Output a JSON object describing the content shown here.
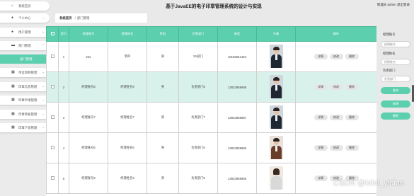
{
  "header": {
    "title": "基于JavaEE的电子印章管理系统的设计与实现",
    "user_info": "管理员 admin  退出登录"
  },
  "sidebar": {
    "items": [
      {
        "label": "系统首页",
        "icon": "home-icon",
        "chevron": false
      },
      {
        "label": "个人中心",
        "icon": "person-icon",
        "chevron": true
      },
      {
        "label": "用户管理",
        "icon": "users-icon",
        "chevron": true
      },
      {
        "label": "部门管理",
        "icon": "department-icon",
        "chevron": true
      },
      {
        "label": "部门管理",
        "icon": "",
        "chevron": false,
        "active": true
      },
      {
        "label": "单位简称管理",
        "icon": "grid-icon",
        "chevron": true
      },
      {
        "label": "印章信息管理",
        "icon": "grid-icon",
        "chevron": true
      },
      {
        "label": "印章申请管理",
        "icon": "grid-icon",
        "chevron": true
      },
      {
        "label": "印章审核管理",
        "icon": "grid-icon",
        "chevron": true
      },
      {
        "label": "印章下发管理",
        "icon": "grid-icon",
        "chevron": true
      }
    ]
  },
  "breadcrumb": {
    "home": "系统首页",
    "separator": "/",
    "current": "部门管理"
  },
  "table": {
    "columns": [
      "",
      "索引",
      "经理账号",
      "经理姓名",
      "性别",
      "负责部门",
      "电话",
      "头像",
      "操作"
    ],
    "rows": [
      {
        "index": "1",
        "account": "222",
        "name": "李四",
        "gender": "男",
        "dept": "XX部门",
        "phone": "18156561454"
      },
      {
        "index": "2",
        "account": "经理账号8",
        "name": "经理姓名8",
        "gender": "男",
        "dept": "负责部门8",
        "phone": "13823888888"
      },
      {
        "index": "3",
        "account": "经理账号7",
        "name": "经理姓名7",
        "gender": "男",
        "dept": "负责部门7",
        "phone": "13823888887"
      },
      {
        "index": "4",
        "account": "经理账号6",
        "name": "经理姓名6",
        "gender": "男",
        "dept": "负责部门6",
        "phone": "13823888886"
      },
      {
        "index": "5",
        "account": "经理账号5",
        "name": "经理姓名5",
        "gender": "男",
        "dept": "负责部门5",
        "phone": "13823888885"
      }
    ],
    "actions": {
      "detail": "详情",
      "edit": "修改",
      "delete": "删除"
    }
  },
  "right_panel": {
    "label_account": "经理账号",
    "placeholder_account": "经理账号",
    "label_name": "经理姓名",
    "placeholder_name": "经理姓名",
    "label_dept": "负责部门",
    "placeholder_dept": "负责部门",
    "search_button": "查询",
    "add_button": "新增",
    "delete_button": "删除"
  },
  "watermark": "CSDN @Mini_yidian",
  "colors": {
    "accent": "#5ccfae",
    "row_alt": "#d8f1ea"
  }
}
